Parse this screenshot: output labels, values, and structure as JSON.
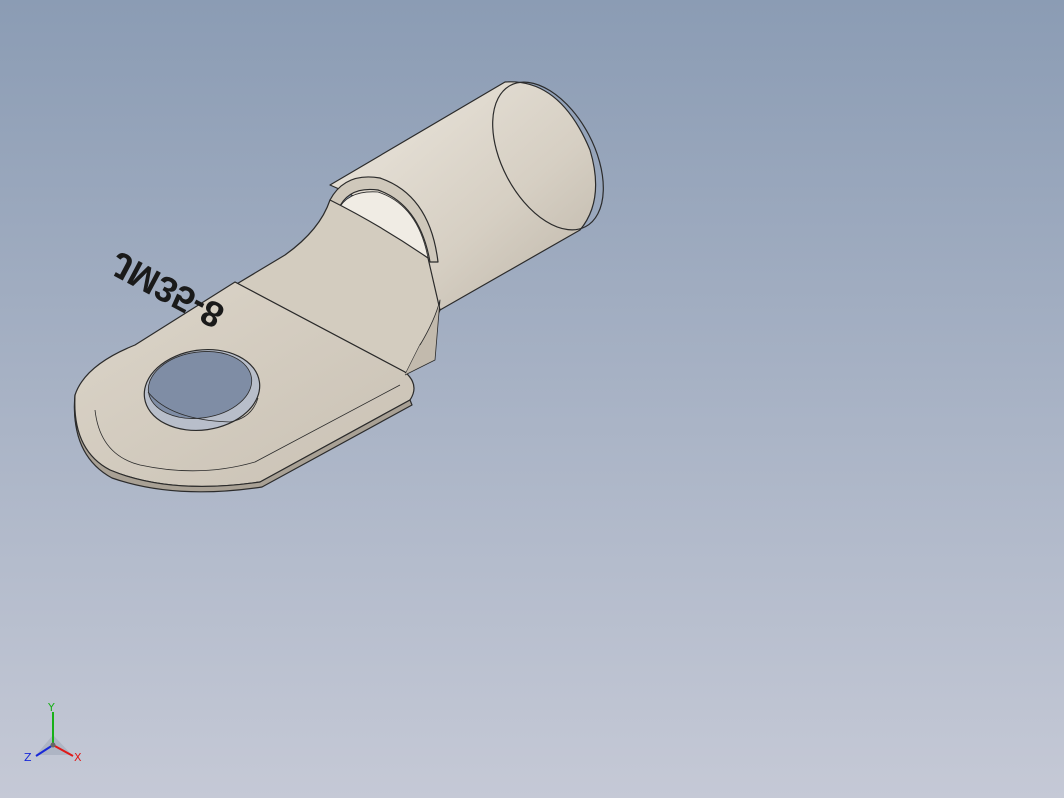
{
  "viewport": {
    "background_top": "#8b9cb4",
    "background_bottom": "#c5c9d6"
  },
  "part": {
    "marking": "JM35-8",
    "body_color": "#d9d2c6",
    "shade_color": "#b8b0a3",
    "edge_color": "#2b2b2b"
  },
  "triad": {
    "x_label": "X",
    "y_label": "Y",
    "z_label": "Z",
    "x_color": "#e01818",
    "y_color": "#18b018",
    "z_color": "#1828d8"
  }
}
